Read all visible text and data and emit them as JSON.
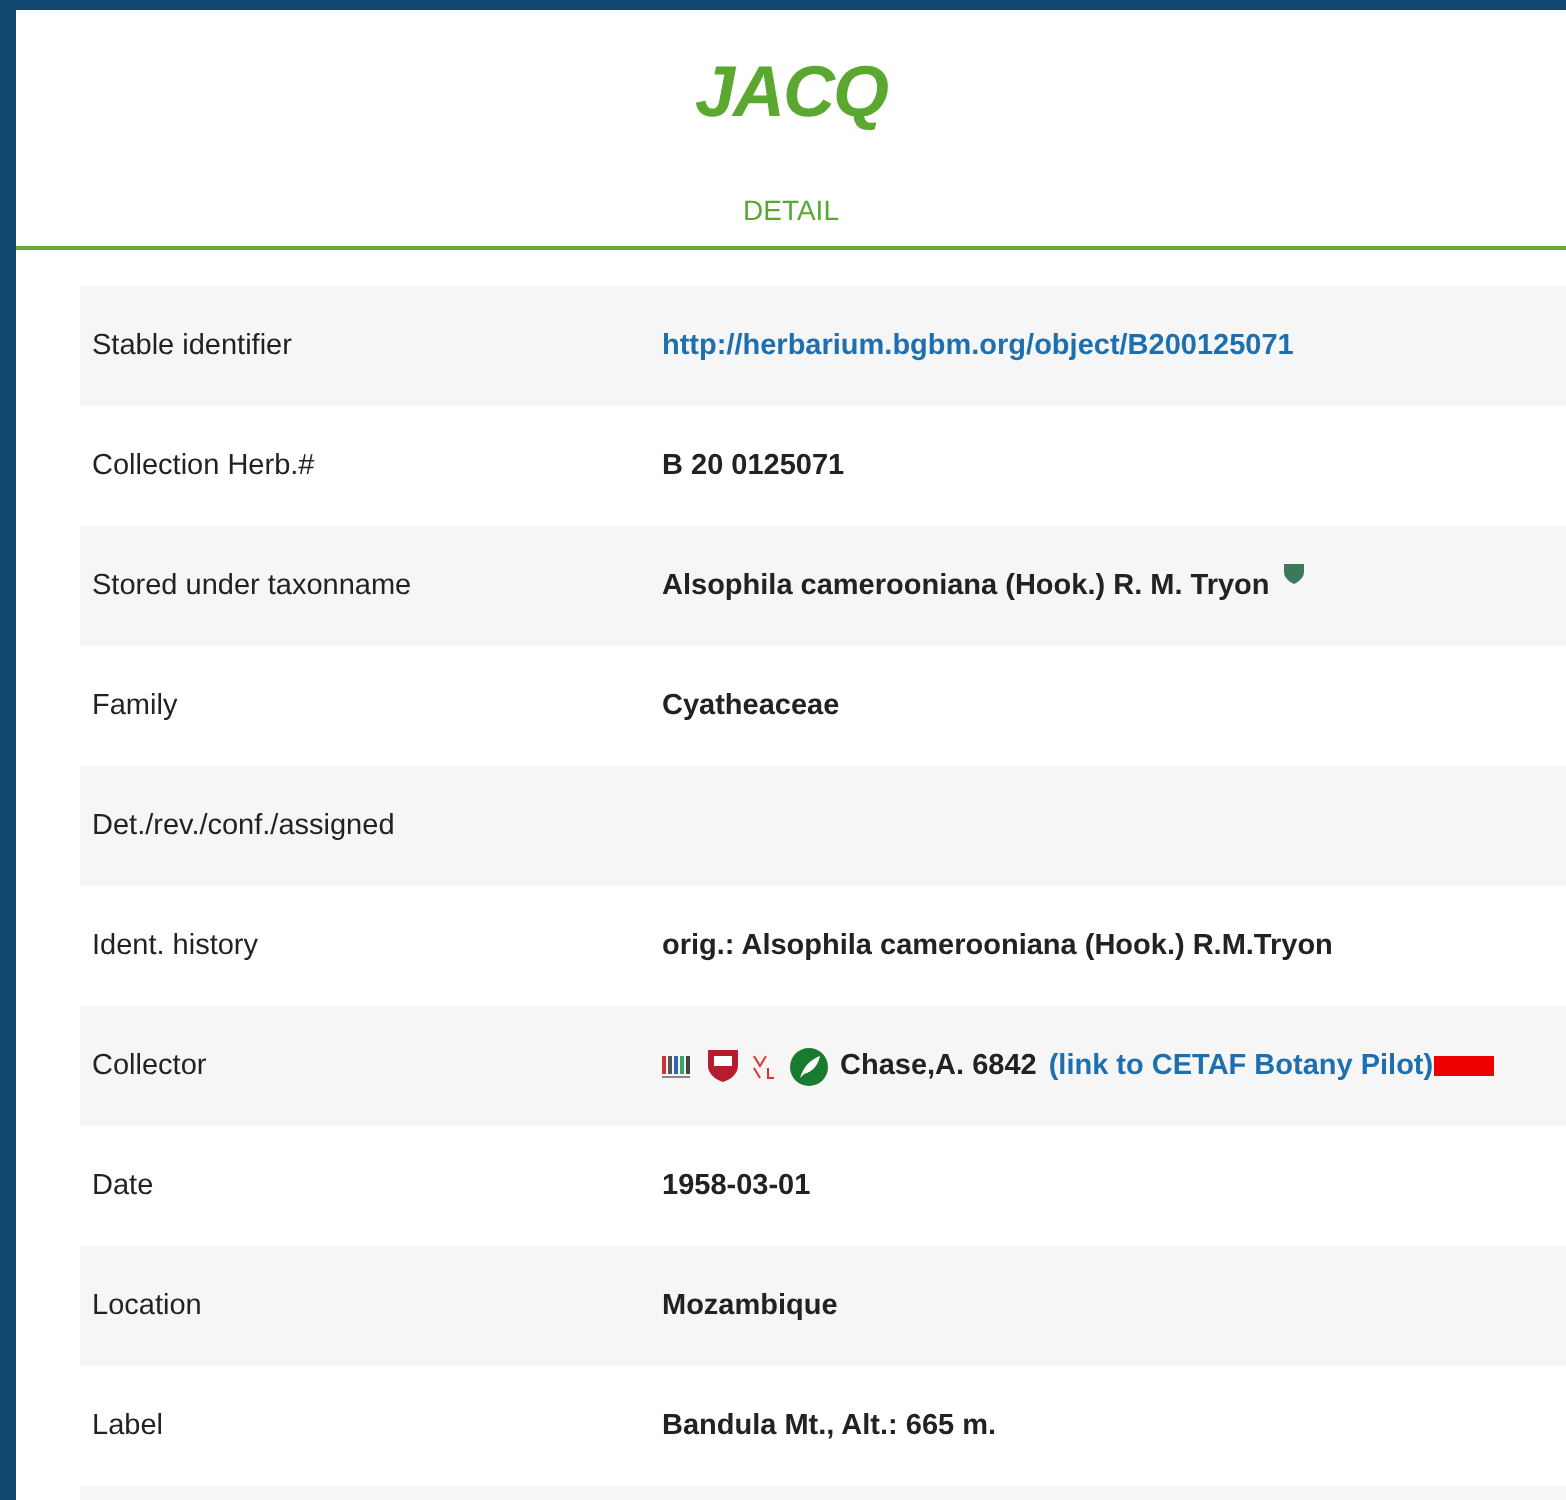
{
  "header": {
    "logo": "JACQ",
    "subtitle": "DETAIL"
  },
  "rows": [
    {
      "kind": "link",
      "label": "Stable identifier",
      "value": "http://herbarium.bgbm.org/object/B200125071"
    },
    {
      "kind": "text",
      "label": "Collection Herb.#",
      "value": "B 20 0125071"
    },
    {
      "kind": "taxon",
      "label": "Stored under taxonname",
      "value": "Alsophila camerooniana (Hook.) R. M. Tryon"
    },
    {
      "kind": "text",
      "label": "Family",
      "value": "Cyatheaceae"
    },
    {
      "kind": "text",
      "label": "Det./rev./conf./assigned"
    },
    {
      "kind": "text",
      "label": "Ident. history",
      "value": "orig.: Alsophila camerooniana (Hook.) R.M.Tryon"
    },
    {
      "kind": "collector",
      "label": "Collector",
      "value": "Chase,A. 6842",
      "link": "(link to CETAF Botany Pilot)"
    },
    {
      "kind": "text",
      "label": "Date",
      "value": "1958-03-01"
    },
    {
      "kind": "text",
      "label": "Location",
      "value": "Mozambique"
    },
    {
      "kind": "text",
      "label": "Label",
      "value": "Bandula Mt., Alt.: 665 m."
    }
  ]
}
